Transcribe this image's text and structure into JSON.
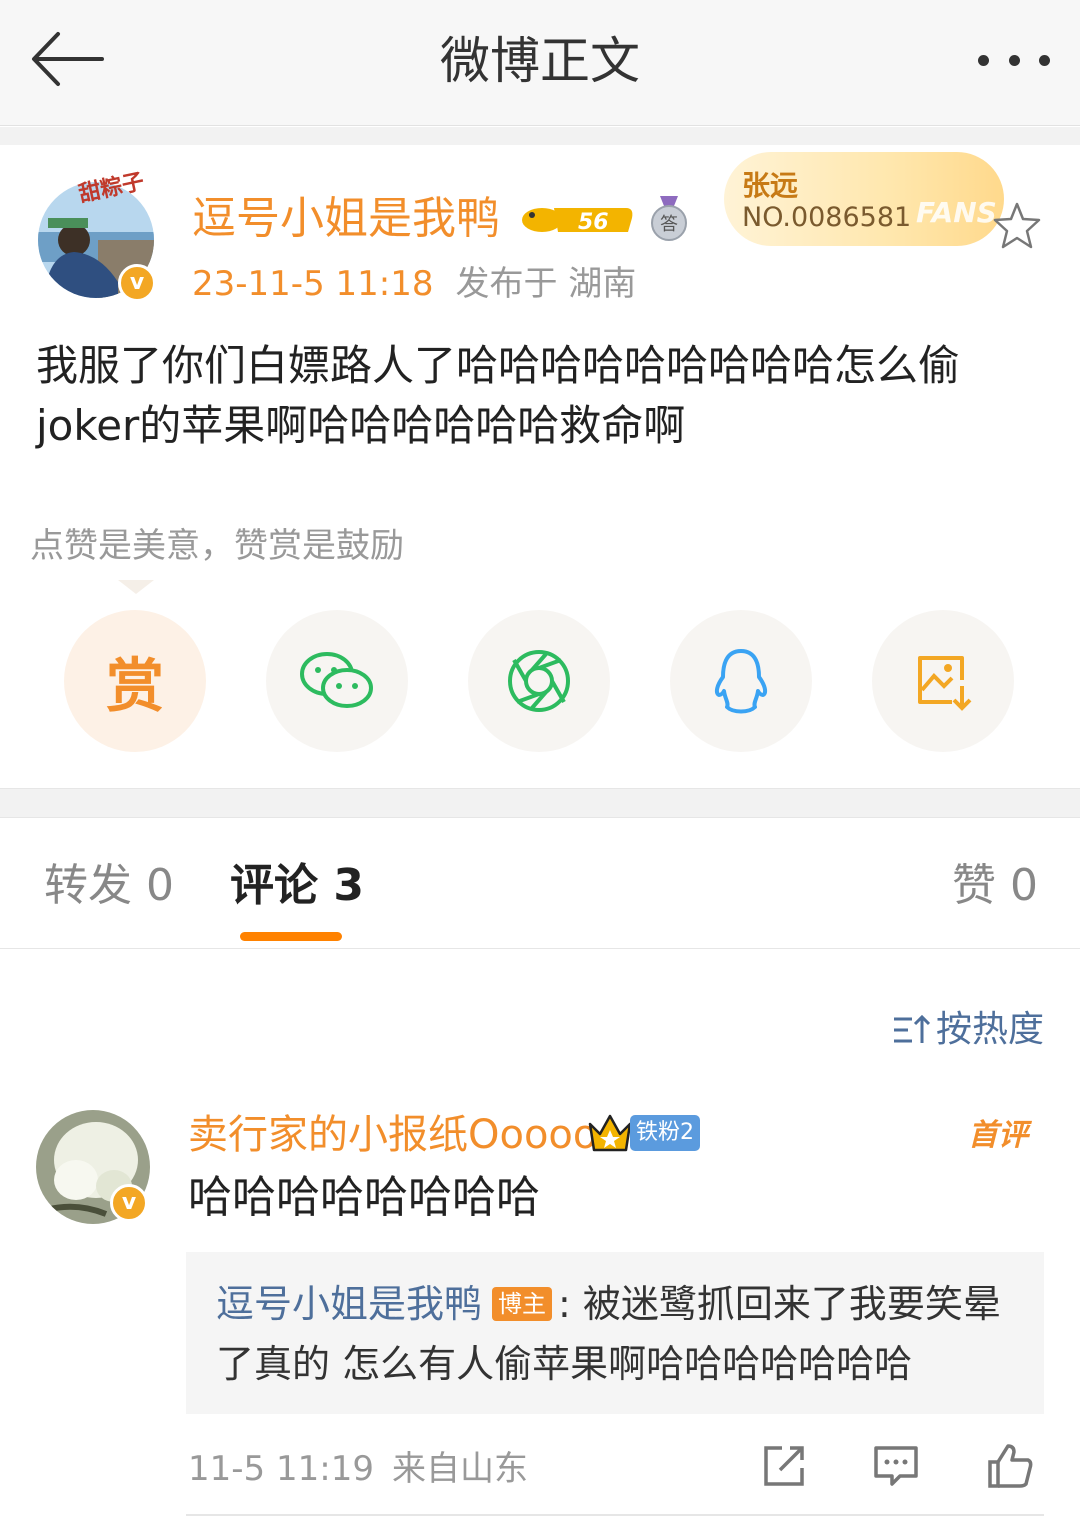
{
  "header": {
    "title": "微博正文"
  },
  "post": {
    "author": "逗号小姐是我鸭",
    "avatar_text": "甜粽子",
    "level": "56",
    "medal_char": "答",
    "time": "23-11-5 11:18",
    "location": "发布于 湖南",
    "fans_card": {
      "name": "张远",
      "number": "NO.0086581",
      "word": "FANS"
    },
    "text": "我服了你们白嫖路人了哈哈哈哈哈哈哈哈哈怎么偷joker的苹果啊哈哈哈哈哈哈救命啊",
    "reward_tip": "点赞是美意，赞赏是鼓励",
    "reward_char": "赏"
  },
  "tabs": [
    {
      "label": "转发 0"
    },
    {
      "label": "评论 3"
    },
    {
      "label": "赞 0"
    }
  ],
  "sort_label": "按热度",
  "comment": {
    "user": "卖行家的小报纸Ooooo",
    "fan_badge": "铁粉2",
    "first_tag": "首评",
    "text": "哈哈哈哈哈哈哈哈",
    "reply": {
      "user": "逗号小姐是我鸭",
      "host_tag": "博主",
      "text": ": 被迷鹭抓回来了我要笑晕了真的 怎么有人偷苹果啊哈哈哈哈哈哈哈"
    },
    "time": "11-5 11:19",
    "from": "来自山东"
  },
  "colors": {
    "accent": "#f28e2b",
    "link": "#4e6f9b",
    "active_tab_underline": "#ff8200"
  }
}
